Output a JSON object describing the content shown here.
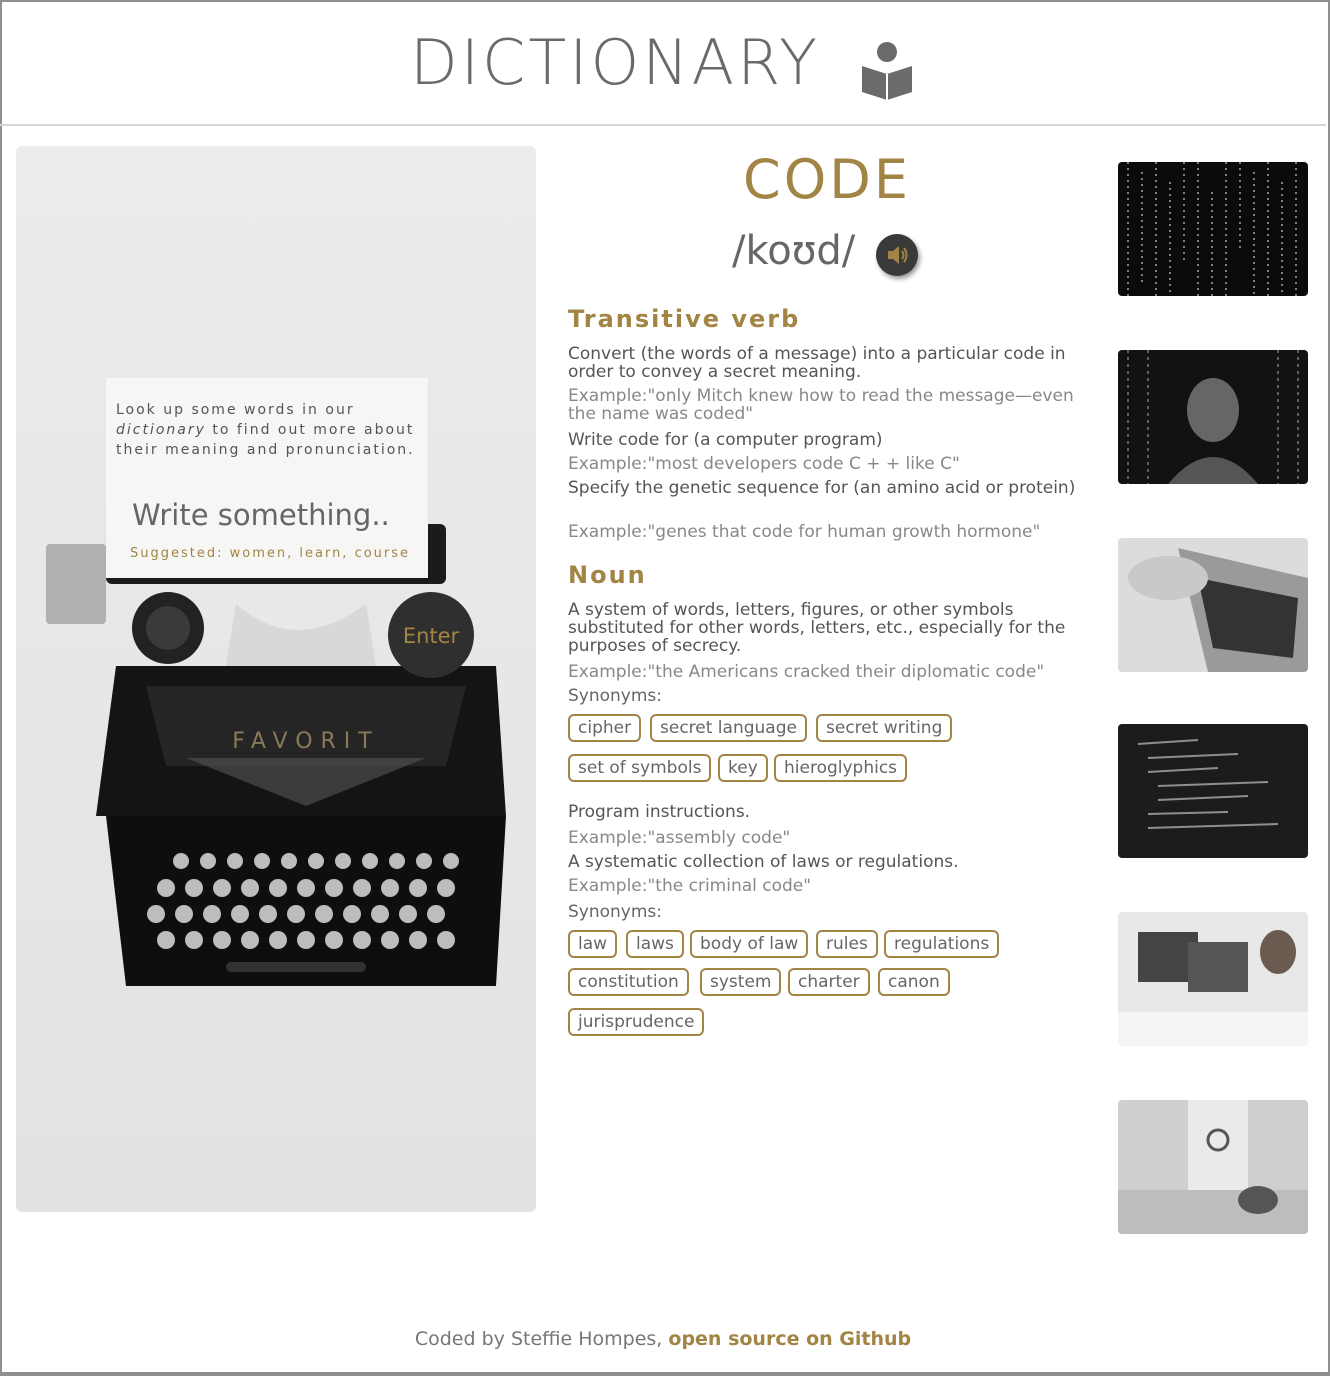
{
  "header": {
    "title": "DICTIONARY",
    "logo_icon": "reader-book-icon"
  },
  "search_panel": {
    "intro_line1": "Look up some words in our",
    "intro_italic": "dictionary",
    "intro_line2": " to find out more about",
    "intro_line3": "their meaning and pronunciation.",
    "placeholder": "Write something..",
    "suggested": "Suggested: women, learn, course",
    "enter_label": "Enter",
    "typewriter_brand": "FAVORIT"
  },
  "entry": {
    "word": "CODE",
    "phonetic": "/koʊd/",
    "audio_icon": "speaker-icon",
    "transitive_verb": {
      "label": "Transitive verb",
      "definitions": [
        {
          "definition": "Convert (the words of a message) into a particular code in order to convey a secret meaning.",
          "example": "Example:\"only Mitch knew how to read the message—even the name was coded\""
        },
        {
          "definition": "Write code for (a computer program)",
          "example": "Example:\"most developers code C + + like C\""
        },
        {
          "definition": "Specify the genetic sequence for (an amino acid or protein)",
          "example": "Example:\"genes that code for human growth hormone\""
        }
      ]
    },
    "noun": {
      "label": "Noun",
      "definitions": [
        {
          "definition": "A system of words, letters, figures, or other symbols substituted for other words, letters, etc., especially for the purposes of secrecy.",
          "example": "Example:\"the Americans cracked their diplomatic code\""
        },
        {
          "definition": "Program instructions.",
          "example": "Example:\"assembly code\""
        },
        {
          "definition": "A systematic collection of laws or regulations.",
          "example": "Example:\"the criminal code\""
        }
      ],
      "synonyms_label": "Synonyms:",
      "synonyms_1": [
        "cipher",
        "secret language",
        "secret writing",
        "set of symbols",
        "key",
        "hieroglyphics"
      ],
      "synonyms_2": [
        "law",
        "laws",
        "body of law",
        "rules",
        "regulations",
        "constitution",
        "system",
        "charter",
        "canon",
        "jurisprudence"
      ]
    }
  },
  "footer": {
    "text": "Coded by Steffie Hompes, ",
    "link": "open source on Github"
  },
  "colors": {
    "accent": "#a28445",
    "text": "#555555",
    "muted": "#888888"
  }
}
